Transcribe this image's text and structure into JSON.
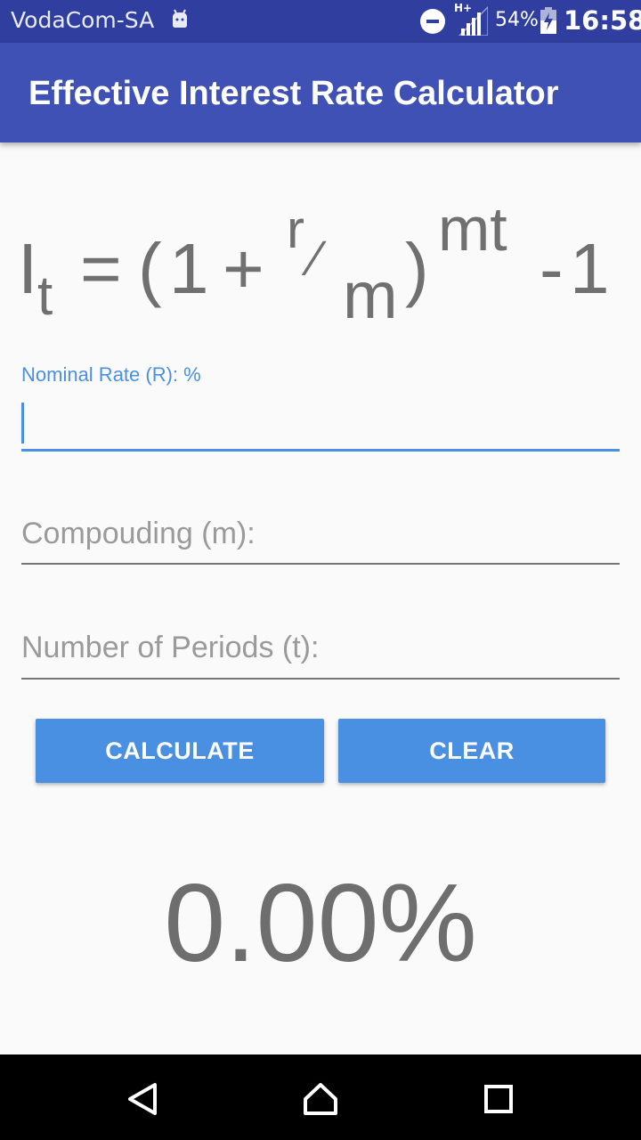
{
  "status_bar": {
    "carrier": "VodaCom-SA",
    "network": "H+",
    "battery_percent": "54%",
    "time": "16:58"
  },
  "app_bar": {
    "title": "Effective Interest Rate Calculator"
  },
  "formula": {
    "I": "I",
    "t_sub": "t",
    "equals": "=",
    "open_paren": "(",
    "one": "1",
    "plus": "+",
    "r": "r",
    "slash": "⁄",
    "m": "m",
    "close_paren": ")",
    "exponent": "mt",
    "minus": "-",
    "one_end": "1"
  },
  "form": {
    "nominal_rate_label": "Nominal Rate (R): %",
    "nominal_rate_value": "",
    "compounding_placeholder": "Compouding (m):",
    "periods_placeholder": "Number of Periods (t):"
  },
  "buttons": {
    "calculate": "CALCULATE",
    "clear": "CLEAR"
  },
  "result": {
    "value": "0.00%"
  },
  "colors": {
    "primary": "#3F51B5",
    "primary_dark": "#303F9F",
    "accent": "#4A90E2"
  }
}
